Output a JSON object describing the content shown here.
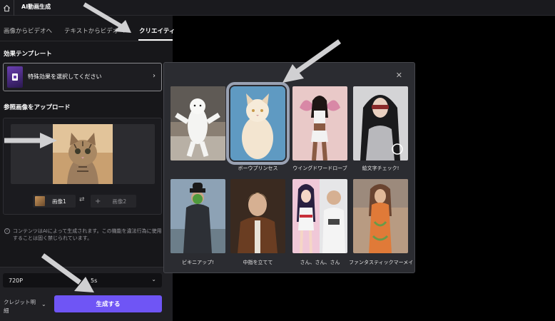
{
  "header": {
    "app_title": "AI動画生成"
  },
  "tabs": [
    {
      "label": "画像からビデオへ"
    },
    {
      "label": "テキストからビデオへ"
    },
    {
      "label": "クリエイティ"
    }
  ],
  "effect_template": {
    "section_title": "効果テンプレート",
    "placeholder": "特殊効果を選択してください"
  },
  "reference_upload": {
    "section_title": "参照画像をアップロード",
    "slot1_label": "画像1",
    "slot2_label": "画像2"
  },
  "notice": "コンテンツはAIによって生成されます。この機能を違法行為に使用することは固く禁じられています。",
  "settings": {
    "resolution": "720P",
    "duration": "5s"
  },
  "credit_label": "クレジット明細",
  "generate_label": "生成する",
  "modal": {
    "templates": [
      {
        "label": ""
      },
      {
        "label": "ボーウプリンセス"
      },
      {
        "label": "ウイングドワードローブ"
      },
      {
        "label": "絵文字チェック!"
      },
      {
        "label": "ビキニアップ!"
      },
      {
        "label": "中指を立てて"
      },
      {
        "label": "さん、さん、さん"
      },
      {
        "label": "ファンタスティックマーメイド"
      }
    ]
  },
  "colors": {
    "accent": "#6f55f5",
    "selected_outline": "#9aa2b3",
    "modal_bg": "#2b2c31"
  }
}
